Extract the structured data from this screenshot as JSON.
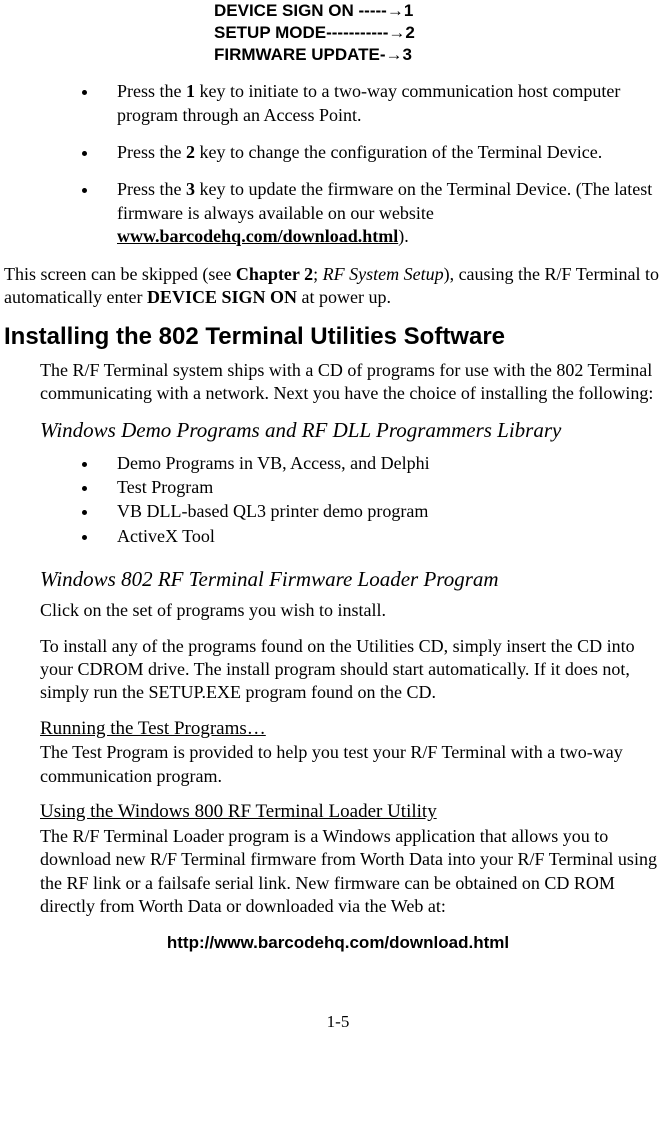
{
  "menu": {
    "line1": "DEVICE SIGN ON -----→1",
    "line2": "SETUP MODE-----------→2",
    "line3": "FIRMWARE UPDATE-→3"
  },
  "bullets_top": {
    "b1_pre": "Press the ",
    "b1_key": "1",
    "b1_post": " key to initiate to a two-way communication host computer program through an Access Point.",
    "b2_pre": "Press the ",
    "b2_key": "2",
    "b2_post": " key to change the configuration of the Terminal Device.",
    "b3_pre": "Press the ",
    "b3_key": "3",
    "b3_mid": " key to update the firmware on the Terminal Device. (The latest firmware is always available on our website ",
    "b3_link": "www.barcodehq.com/download.html",
    "b3_end": ")."
  },
  "skip_para": {
    "t1": "This screen can be skipped (see ",
    "chapter": "Chapter 2",
    "semi": "; ",
    "rfsetup": "RF System Setup",
    "t2": "), causing the R/F Terminal to automatically enter ",
    "device": "DEVICE SIGN ON",
    "t3": " at power up."
  },
  "section_title": "Installing the 802 Terminal Utilities Software",
  "intro_para": "The R/F Terminal system ships with a CD of programs for use with the 802 Terminal communicating with a network. Next you have the choice of installing the following:",
  "sub1": "Windows Demo Programs and RF DLL Programmers Library",
  "list2": {
    "i1": "Demo Programs in VB, Access, and Delphi",
    "i2": "Test Program",
    "i3": "VB DLL-based QL3 printer demo program",
    "i4": "ActiveX Tool"
  },
  "sub2": "Windows 802 RF Terminal Firmware Loader Program",
  "click_para": "Click on the set of programs you wish to install.",
  "install_para": "To install any of the programs found on the Utilities CD, simply insert the CD into your CDROM drive. The install program should start automatically.  If it does not, simply run the SETUP.EXE program found on the CD.",
  "run_heading": "Running the Test Programs…",
  "run_para": "The Test Program is provided to help you test your R/F Terminal with a two-way communication program.",
  "loader_heading": "Using the Windows 800 RF Terminal Loader Utility",
  "loader_para": "The R/F Terminal Loader program is a Windows application that allows you to download new R/F Terminal firmware from Worth Data into your R/F Terminal using the RF link or a failsafe serial link.  New firmware can be obtained on CD ROM directly from Worth Data or downloaded via the Web at:",
  "bottom_link": "http://www.barcodehq.com/download.html",
  "pagenum": "1-5"
}
